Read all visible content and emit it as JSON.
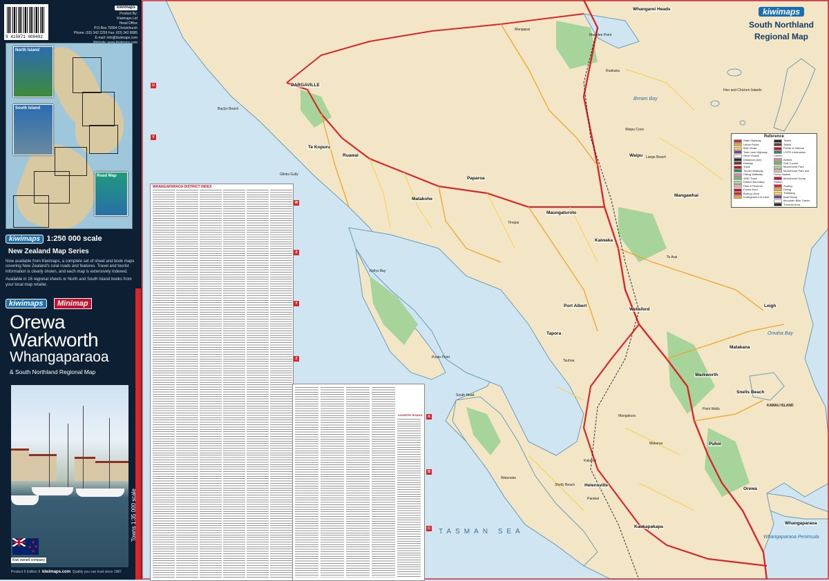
{
  "cover": {
    "barcode_number": "9 415871 000492",
    "publisher": {
      "tag": "kiwimaps",
      "lines": [
        "Product By:",
        "Kiwimaps Ltd",
        "Head Office",
        "P.O.Box 79994 Christchurch",
        "Phone: (03) 342 2259  Fax: (03) 342 8085",
        "E-mail: info@kiwimaps.com",
        "Website: www.kiwimaps.com"
      ]
    },
    "index_books": [
      {
        "label": "North Island"
      },
      {
        "label": "South Island"
      },
      {
        "label": "Road Map"
      }
    ],
    "series": {
      "logo": "kiwimaps",
      "scale": "1:250 000 scale",
      "subtitle": "New Zealand Map Series",
      "paragraph1": "Now available from Kiwimaps, a complete set of sheet and book maps covering New Zealand's rural roads and features. Travel and tourist information is clearly shown, and each map is extensively indexed.",
      "paragraph2": "Available in 16 regional sheets or North and South Island books from your local map retailer."
    },
    "logo_kiwimaps": "kiwimaps",
    "logo_minimap": "Minimap",
    "title_line1": "Orewa",
    "title_line2": "Warkworth",
    "title_line3": "Whangaparaoa",
    "subtitle": "& South Northland Regional Map",
    "kiwi_owned": "Kiwi owned company",
    "footer_left": "Product 6 Edition 9",
    "footer_site": "kiwimaps.com",
    "footer_tagline": "Quality you can trust since 1987",
    "towns_scale": "Towns 1:35 000 scale"
  },
  "index": {
    "heading": "WHANGAPARAOA DISTRICT INDEX",
    "heading2": "COUNTRY ROADS"
  },
  "map": {
    "brand_logo": "kiwimaps",
    "brand_title_1": "South Northland",
    "brand_title_2": "Regional Map",
    "sea": "TASMAN SEA",
    "legend": {
      "title": "Reference",
      "left": [
        "State Highway",
        "Urban Route",
        "Main Road",
        "Twin Lane Highway",
        "Other Roads",
        "Distances (km)",
        "Railway",
        "Track",
        "Tourist Walkway",
        "Hiking Walkway",
        "4WD Track",
        "District Boundary",
        "Park & Reserve",
        "Forest Area",
        "Built-up Area",
        "Enlargement to Inset"
      ],
      "right": [
        "Towns",
        "Toilets",
        "Points of Interest",
        "i-SITE Information Centre",
        "Airfield",
        "Golf Course",
        "Motorhome Park",
        "Motorhome Park and Dump Station",
        "Motorhome Dump Station",
        "Surfing",
        "Diving",
        "Tramping",
        "Boat Ramp",
        "Mountain Bike Tracks",
        "Thermal Area"
      ]
    },
    "legend_colors": [
      "#d9262b",
      "#f2a32a",
      "#f6d04a",
      "#7a3fa0",
      "#ffffff",
      "#2a2a2a",
      "#6b3b1e",
      "#c8102e",
      "#2e8b57",
      "#c98ab0",
      "#77b55a",
      "#a7d49a",
      "#e6b2b2",
      "#c8102e"
    ],
    "places": [
      {
        "name": "DARGAVILLE",
        "cls": "town"
      },
      {
        "name": "Whangarei Heads",
        "cls": "town"
      },
      {
        "name": "Waipu",
        "cls": "town"
      },
      {
        "name": "Mangawhai",
        "cls": "town"
      },
      {
        "name": "Kaiwaka",
        "cls": "town"
      },
      {
        "name": "Wellsford",
        "cls": "town"
      },
      {
        "name": "Warkworth",
        "cls": "town"
      },
      {
        "name": "Helensville",
        "cls": "town"
      },
      {
        "name": "Orewa",
        "cls": "town"
      },
      {
        "name": "Whangaparaoa",
        "cls": "town"
      },
      {
        "name": "Ruawai",
        "cls": "town"
      },
      {
        "name": "Te Kopuru",
        "cls": "town"
      },
      {
        "name": "Maungaturoto",
        "cls": "town"
      },
      {
        "name": "Paparoa",
        "cls": "town"
      },
      {
        "name": "Matakohe",
        "cls": "town"
      },
      {
        "name": "Port Albert",
        "cls": "town"
      },
      {
        "name": "Tapora",
        "cls": "town"
      },
      {
        "name": "Kaukapakapa",
        "cls": "town"
      },
      {
        "name": "Puhoi",
        "cls": "town"
      },
      {
        "name": "Leigh",
        "cls": "town"
      },
      {
        "name": "Matakana",
        "cls": "town"
      },
      {
        "name": "Snells Beach",
        "cls": "town"
      },
      {
        "name": "South Head",
        "cls": "lbl"
      },
      {
        "name": "Shelly Beach",
        "cls": "lbl"
      },
      {
        "name": "Parakai",
        "cls": "lbl"
      },
      {
        "name": "Waioneke",
        "cls": "lbl"
      },
      {
        "name": "Kakanui",
        "cls": "lbl"
      },
      {
        "name": "Makarau",
        "cls": "lbl"
      },
      {
        "name": "Mangakura",
        "cls": "lbl"
      },
      {
        "name": "Tauhoa",
        "cls": "lbl"
      },
      {
        "name": "Te Arai",
        "cls": "lbl"
      },
      {
        "name": "Marsden Point",
        "cls": "lbl"
      },
      {
        "name": "Ruakaka",
        "cls": "lbl"
      },
      {
        "name": "Langs Beach",
        "cls": "lbl"
      },
      {
        "name": "Pouto Point",
        "cls": "lbl"
      },
      {
        "name": "Tinopai",
        "cls": "lbl"
      },
      {
        "name": "Kellys Bay",
        "cls": "lbl"
      },
      {
        "name": "Glinks Gully",
        "cls": "lbl"
      },
      {
        "name": "Baylys Beach",
        "cls": "lbl"
      },
      {
        "name": "Mangapai",
        "cls": "lbl"
      },
      {
        "name": "Waipu Cove",
        "cls": "lbl"
      },
      {
        "name": "Point Wells",
        "cls": "lbl"
      },
      {
        "name": "Omaha Bay",
        "cls": "bay"
      },
      {
        "name": "Bream Bay",
        "cls": "bay"
      },
      {
        "name": "Whangaparaoa Peninsula",
        "cls": "bay"
      },
      {
        "name": "Hen and Chicken Islands",
        "cls": "lbl"
      },
      {
        "name": "KAWAU ISLAND",
        "cls": "lbl"
      }
    ],
    "grid_letters": [
      "U",
      "V",
      "W",
      "X",
      "Y",
      "Z",
      "A",
      "B",
      "C"
    ]
  }
}
